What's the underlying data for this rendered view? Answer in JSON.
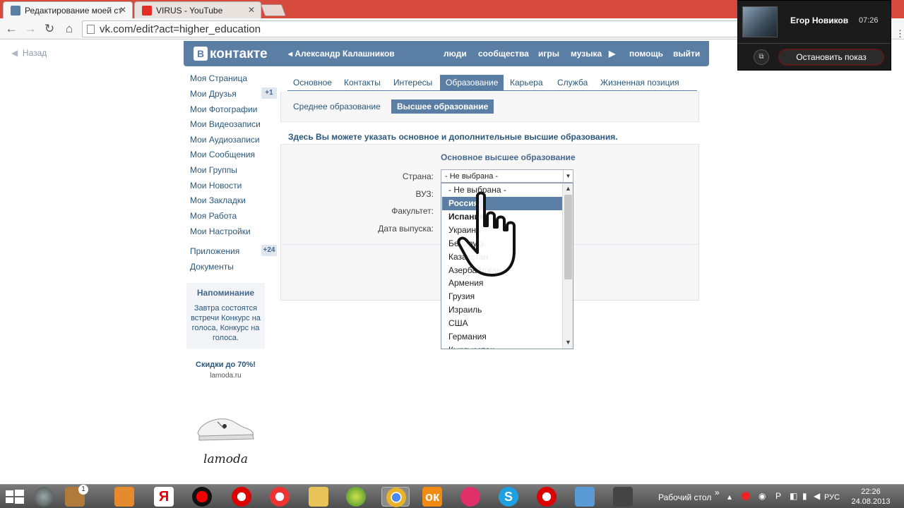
{
  "browser": {
    "tabs": [
      {
        "label": "Редактирование моей ст",
        "close": "✕"
      },
      {
        "label": "VIRUS - YouTube",
        "close": "✕"
      }
    ],
    "url": "vk.com/edit?act=higher_education"
  },
  "overlay": {
    "user": "Егор Новиков",
    "time": "07:26",
    "stop_label": "Остановить показ"
  },
  "page": {
    "back": "Назад",
    "header": {
      "logo": "контакте",
      "logo_letter": "B",
      "user": "Александр Калашников",
      "nav": [
        "люди",
        "сообщества",
        "игры",
        "музыка",
        "помощь",
        "выйти"
      ]
    },
    "sidebar": {
      "items": [
        {
          "label": "Моя Страница"
        },
        {
          "label": "Мои Друзья",
          "badge": "+1"
        },
        {
          "label": "Мои Фотографии"
        },
        {
          "label": "Мои Видеозаписи"
        },
        {
          "label": "Мои Аудиозаписи"
        },
        {
          "label": "Мои Сообщения"
        },
        {
          "label": "Мои Группы"
        },
        {
          "label": "Мои Новости"
        },
        {
          "label": "Мои Закладки"
        },
        {
          "label": "Моя Работа"
        },
        {
          "label": "Мои Настройки"
        },
        {
          "label": "Приложения",
          "badge": "+24"
        },
        {
          "label": "Документы"
        }
      ],
      "reminder_title": "Напоминание",
      "reminder_text": "Завтра состоятся встречи Конкурс на голоса, Конкурс на голоса.",
      "ad_title": "Скидки до 70%!",
      "ad_url": "lamoda.ru",
      "ad_brand": "lamoda"
    },
    "tabs": [
      "Основное",
      "Контакты",
      "Интересы",
      "Образование",
      "Карьера",
      "Служба",
      "Жизненная позиция"
    ],
    "active_tab": "Образование",
    "subtabs": [
      "Среднее образование",
      "Высшее образование"
    ],
    "hint": "Здесь Вы можете указать основное и дополнительные высшие образования.",
    "section_title": "Основное высшее образование",
    "fields": [
      "Страна:",
      "ВУЗ:",
      "Факультет:",
      "Дата выпуска:"
    ],
    "country_value": "- Не выбрана -",
    "dropdown_options": [
      "- Не выбрана -",
      "Россия",
      "Испания",
      "Украина",
      "Беларусь",
      "Казахстан",
      "Азербайджан",
      "Армения",
      "Грузия",
      "Израиль",
      "США",
      "Германия",
      "Кыргызстан"
    ],
    "selected_option": "Россия"
  },
  "taskbar": {
    "tray_label": "Рабочий стол",
    "lang": "РУС",
    "time": "22:26",
    "date": "24.08.2013",
    "badge": "1"
  },
  "colors": {
    "vk_blue": "#5b7ea5",
    "link": "#2b587a",
    "chrome_red": "#d64a3e"
  }
}
